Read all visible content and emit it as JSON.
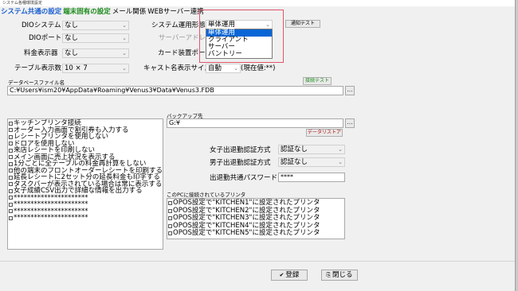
{
  "window": {
    "title": "システム各種環境設定"
  },
  "tabs": [
    "システム共通の設定",
    "端末固有の設定",
    "メール関係",
    "WEBサーバー連携"
  ],
  "fields": {
    "dio_system": {
      "label": "DIOシステム",
      "value": "なし"
    },
    "dio_port": {
      "label": "DIOポート",
      "value": "なし"
    },
    "fee_display": {
      "label": "料金表示器",
      "value": "なし"
    },
    "table_count": {
      "label": "テーブル表示数",
      "value": "10 × 7"
    },
    "system_mode": {
      "label": "システム運用形態",
      "value": "単体運用"
    },
    "server_address": {
      "label": "サーバーアドレス"
    },
    "card_port": {
      "label": "カード装置ポート"
    },
    "cast_size": {
      "label": "キャスト名表示サイズ",
      "value": "自動",
      "current": "(現在値:**)"
    },
    "notify_test": "通知テスト",
    "db_file_label": "データベースファイル名",
    "db_file_value": "C:¥Users¥ism20¥AppData¥Roaming¥Venus3¥Data¥Venus3.FDB",
    "connect_test": "接続テスト",
    "backup_label": "バックアップ先",
    "backup_value": "G:¥",
    "data_restore": "データリストア",
    "female_auth": {
      "label": "女子出退勤認証方式",
      "value": "認証なし"
    },
    "male_auth": {
      "label": "男子出退勤認証方式",
      "value": "認証なし"
    },
    "shared_password": {
      "label": "出退勤共通パスワード",
      "value": "****"
    },
    "printers_label": "このPCに接続されているプリンタ"
  },
  "dropdown_options": [
    "単体運用",
    "クライアント",
    "サーバー",
    "バントリー"
  ],
  "checklist": [
    "キッチンプリンタ接続",
    "オーダー入力画面で割引券も入力する",
    "レシートプリンタを使用しない",
    "ドロアを使用しない",
    "来店レシートを印刷しない",
    "メイン画面に売上状況を表示する",
    "1分ごとに全テーブルの料金再計算をしない",
    "他の端末のフロントオーダーレシートを印刷する",
    "延長レシートに2セット分の延長料金も印字する",
    "タスクバーが表示されている場合は常に表示する",
    "女子成績CSV出力で詳細な情報を出力する",
    "**********************",
    "**********************",
    "**********************",
    "**********************"
  ],
  "printers": [
    "OPOS設定で\"KITCHEN1\"に設定されたプリンタ",
    "OPOS設定で\"KITCHEN2\"に設定されたプリンタ",
    "OPOS設定で\"KITCHEN3\"に設定されたプリンタ",
    "OPOS設定で\"KITCHEN4\"に設定されたプリンタ",
    "OPOS設定で\"KITCHEN5\"に設定されたプリンタ"
  ],
  "footer": {
    "register": "登録",
    "close": "閉じる"
  },
  "colors": {
    "active_tab": "#1a5fd0",
    "brand_tab": "#1a8a1a",
    "highlight_box": "#e0556a",
    "selection": "#0a66d6"
  },
  "icons": {
    "register": "check-icon",
    "close": "close-icon",
    "combo_arrow": "chevron-down-icon"
  }
}
